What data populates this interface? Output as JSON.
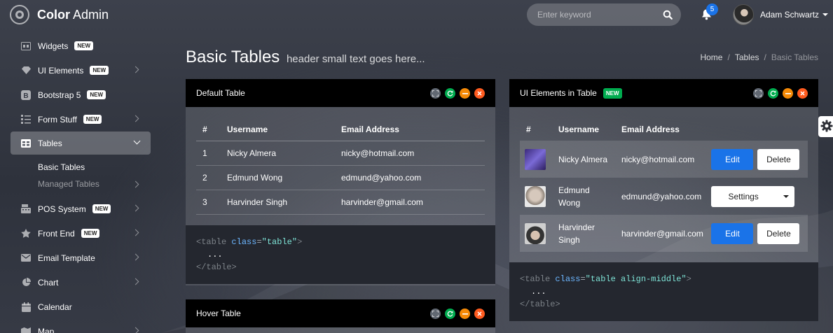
{
  "app": {
    "brand_bold": "Color",
    "brand_rest": " Admin"
  },
  "header": {
    "search_placeholder": "Enter keyword",
    "notification_count": "5",
    "user_name": "Adam Schwartz"
  },
  "sidebar": {
    "items": [
      {
        "label": "Widgets",
        "icon": "widgets-icon",
        "badge": "NEW"
      },
      {
        "label": "UI Elements",
        "icon": "gem-icon",
        "badge": "NEW"
      },
      {
        "label": "Bootstrap 5",
        "icon": "bootstrap-icon",
        "badge": "NEW"
      },
      {
        "label": "Form Stuff",
        "icon": "list-icon",
        "badge": "NEW"
      },
      {
        "label": "Tables",
        "icon": "table-icon"
      },
      {
        "label": "POS System",
        "icon": "register-icon",
        "badge": "NEW"
      },
      {
        "label": "Front End",
        "icon": "star-icon",
        "badge": "NEW"
      },
      {
        "label": "Email Template",
        "icon": "envelope-icon"
      },
      {
        "label": "Chart",
        "icon": "pie-chart-icon"
      },
      {
        "label": "Calendar",
        "icon": "calendar-icon"
      },
      {
        "label": "Map",
        "icon": "map-icon"
      }
    ],
    "sub_items": [
      "Basic Tables",
      "Managed Tables"
    ]
  },
  "page": {
    "title": "Basic Tables",
    "subtitle": "header small text goes here...",
    "breadcrumb": [
      "Home",
      "Tables",
      "Basic Tables"
    ]
  },
  "default_table": {
    "title": "Default Table",
    "columns": [
      "#",
      "Username",
      "Email Address"
    ],
    "rows": [
      [
        "1",
        "Nicky Almera",
        "nicky@hotmail.com"
      ],
      [
        "2",
        "Edmund Wong",
        "edmund@yahoo.com"
      ],
      [
        "3",
        "Harvinder Singh",
        "harvinder@gmail.com"
      ]
    ],
    "code": {
      "open_tag": "<table",
      "attr": "class",
      "value": "\"table\"",
      "close_open": ">",
      "ellipsis": "...",
      "close_tag": "</table>"
    }
  },
  "ui_table": {
    "title": "UI Elements in Table",
    "badge": "NEW",
    "columns": [
      "#",
      "Username",
      "Email Address"
    ],
    "rows": [
      {
        "name_l1": "Nicky Almera",
        "name_l2": "",
        "email": "nicky@hotmail.com",
        "action1": "Edit",
        "action2": "Delete"
      },
      {
        "name_l1": "Edmund",
        "name_l2": "Wong",
        "email": "edmund@yahoo.com",
        "action1": "Settings"
      },
      {
        "name_l1": "Harvinder",
        "name_l2": "Singh",
        "email": "harvinder@gmail.com",
        "action1": "Edit",
        "action2": "Delete"
      }
    ],
    "code": {
      "open_tag": "<table",
      "attr": "class",
      "value": "\"table align-middle\"",
      "close_open": ">",
      "ellipsis": "...",
      "close_tag": "</table>"
    }
  },
  "hover_table": {
    "title": "Hover Table"
  },
  "colors": {
    "accent_blue": "#1a73e8",
    "green": "#00ac4f",
    "orange": "#f58a07",
    "red": "#ff5b1f"
  }
}
